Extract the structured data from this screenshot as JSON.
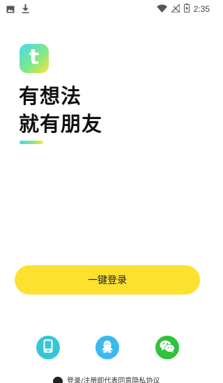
{
  "status_bar": {
    "time": "2:35",
    "icons": [
      "image-icon",
      "download-icon",
      "wifi-icon",
      "signal-icon",
      "battery-charging-icon"
    ]
  },
  "app": {
    "logo_letter": "t",
    "slogan_line1": "有想法",
    "slogan_line2": "就有朋友",
    "accent_colors": [
      "#3fd6ef",
      "#8ee97d",
      "#ffe632"
    ]
  },
  "login": {
    "button_label": "一键登录",
    "button_color": "#fce12f"
  },
  "social_login": {
    "options": [
      {
        "name": "phone",
        "icon": "phone-icon",
        "color": "#35c6d6"
      },
      {
        "name": "qq",
        "icon": "qq-icon",
        "color": "#3ab9f0"
      },
      {
        "name": "wechat",
        "icon": "wechat-icon",
        "color": "#2fc23d"
      }
    ]
  },
  "agreement": {
    "text": "登录/注册即代表同意隐私协议"
  }
}
